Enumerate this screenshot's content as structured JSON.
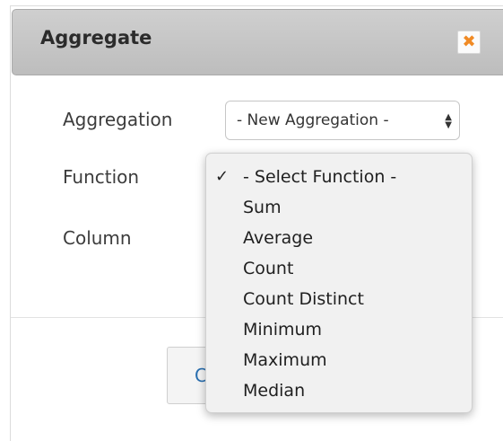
{
  "dialog": {
    "title": "Aggregate",
    "close_icon": "close-icon",
    "accent": "#f08a24"
  },
  "form": {
    "aggregation_label": "Aggregation",
    "function_label": "Function",
    "column_label": "Column",
    "aggregation_value": "- New Aggregation -"
  },
  "dropdown": {
    "checked_index": 0,
    "options": [
      "- Select Function -",
      "Sum",
      "Average",
      "Count",
      "Count Distinct",
      "Minimum",
      "Maximum",
      "Median"
    ]
  },
  "footer": {
    "partial_button_text": "C"
  }
}
